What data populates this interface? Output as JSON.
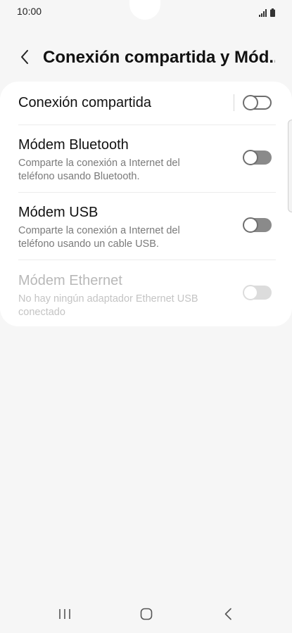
{
  "status_bar": {
    "time": "10:00"
  },
  "header": {
    "title": "Conexión compartida y Mód..."
  },
  "settings": {
    "items": [
      {
        "title": "Conexión compartida",
        "description": "",
        "enabled": true,
        "state": "off"
      },
      {
        "title": "Módem Bluetooth",
        "description": "Comparte la conexión a Internet del teléfono usando Bluetooth.",
        "enabled": true,
        "state": "off"
      },
      {
        "title": "Módem USB",
        "description": "Comparte la conexión a Internet del teléfono usando un cable USB.",
        "enabled": true,
        "state": "off"
      },
      {
        "title": "Módem Ethernet",
        "description": "No hay ningún adaptador Ethernet USB conectado",
        "enabled": false,
        "state": "off"
      }
    ]
  },
  "icons": {
    "back": "chevron-left-icon",
    "signal": "signal-icon",
    "battery": "battery-icon",
    "recent_apps": "recent-apps-icon",
    "home": "home-icon",
    "nav_back": "back-icon"
  },
  "colors": {
    "background": "#f6f6f6",
    "card": "#ffffff",
    "toggle_off": "#8a8a8a",
    "disabled_text": "#b8b8b8"
  }
}
